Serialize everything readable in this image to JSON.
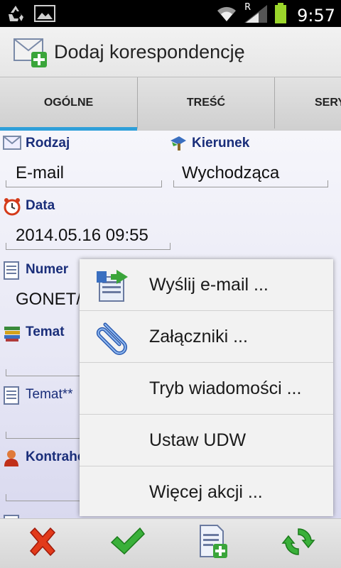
{
  "status_bar": {
    "time": "9:57",
    "network_letter": "R",
    "icons": [
      "recycle-icon",
      "image-icon",
      "wifi-icon",
      "signal-icon",
      "battery-icon"
    ]
  },
  "titlebar": {
    "title": "Dodaj korespondencję",
    "icon": "mail-add-icon"
  },
  "tabs": [
    {
      "label": "OGÓLNE",
      "active": true
    },
    {
      "label": "TREŚĆ",
      "active": false
    },
    {
      "label": "SERY",
      "active": false
    }
  ],
  "form": {
    "rodzaj": {
      "label": "Rodzaj",
      "value": "E-mail"
    },
    "kierunek": {
      "label": "Kierunek",
      "value": "Wychodząca"
    },
    "data": {
      "label": "Data",
      "value": "2014.05.16 09:55"
    },
    "numer": {
      "label": "Numer",
      "value": "GONET/"
    },
    "temat": {
      "label": "Temat",
      "value": ""
    },
    "temat2": {
      "label": "Temat**",
      "value": ""
    },
    "kontrahent": {
      "label": "Kontrahe",
      "value": ""
    }
  },
  "menu": {
    "items": [
      {
        "label": "Wyślij e-mail ...",
        "icon": "send-email-icon"
      },
      {
        "label": "Załączniki ...",
        "icon": "paperclip-icon"
      },
      {
        "label": "Tryb wiadomości ...",
        "icon": ""
      },
      {
        "label": "Ustaw UDW",
        "icon": ""
      },
      {
        "label": "Więcej akcji ...",
        "icon": ""
      }
    ]
  },
  "bottom_bar": {
    "buttons": [
      "cancel-icon",
      "confirm-icon",
      "add-document-icon",
      "refresh-icon"
    ]
  },
  "colors": {
    "accent": "#2e9fd9",
    "label": "#1a2e7a",
    "status_bar": "#000000",
    "battery": "#9bd62b"
  }
}
